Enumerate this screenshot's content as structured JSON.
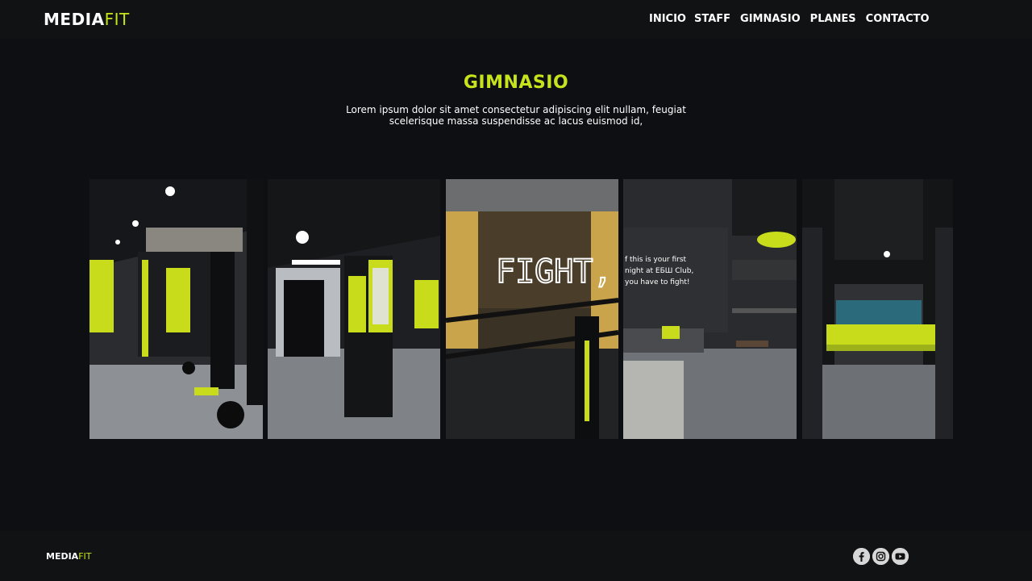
{
  "brand": {
    "part1": "MEDIA",
    "part2": "FIT",
    "accent": "#c6e31b"
  },
  "nav": {
    "items": [
      {
        "label": "INICIO"
      },
      {
        "label": "STAFF"
      },
      {
        "label": "GIMNASIO"
      },
      {
        "label": "PLANES"
      },
      {
        "label": "CONTACTO"
      }
    ]
  },
  "section": {
    "title": "GIMNASIO",
    "description": "Lorem ipsum dolor sit amet consectetur adipiscing elit nullam, feugiat scelerisque massa suspendisse ac lacus euismod id,"
  },
  "gallery": {
    "photos": [
      {
        "name": "gym-weights-room"
      },
      {
        "name": "locker-corridor"
      },
      {
        "name": "fight-neon-sign"
      },
      {
        "name": "lounge-bar",
        "wall_text": [
          "f this is your first",
          "night at ЕБШ Club,",
          "you have to fight!"
        ]
      },
      {
        "name": "washroom-sink"
      }
    ]
  },
  "footer": {
    "brand": {
      "part1": "MEDIA",
      "part2": "FIT"
    },
    "social": [
      "facebook-icon",
      "instagram-icon",
      "youtube-icon"
    ]
  }
}
